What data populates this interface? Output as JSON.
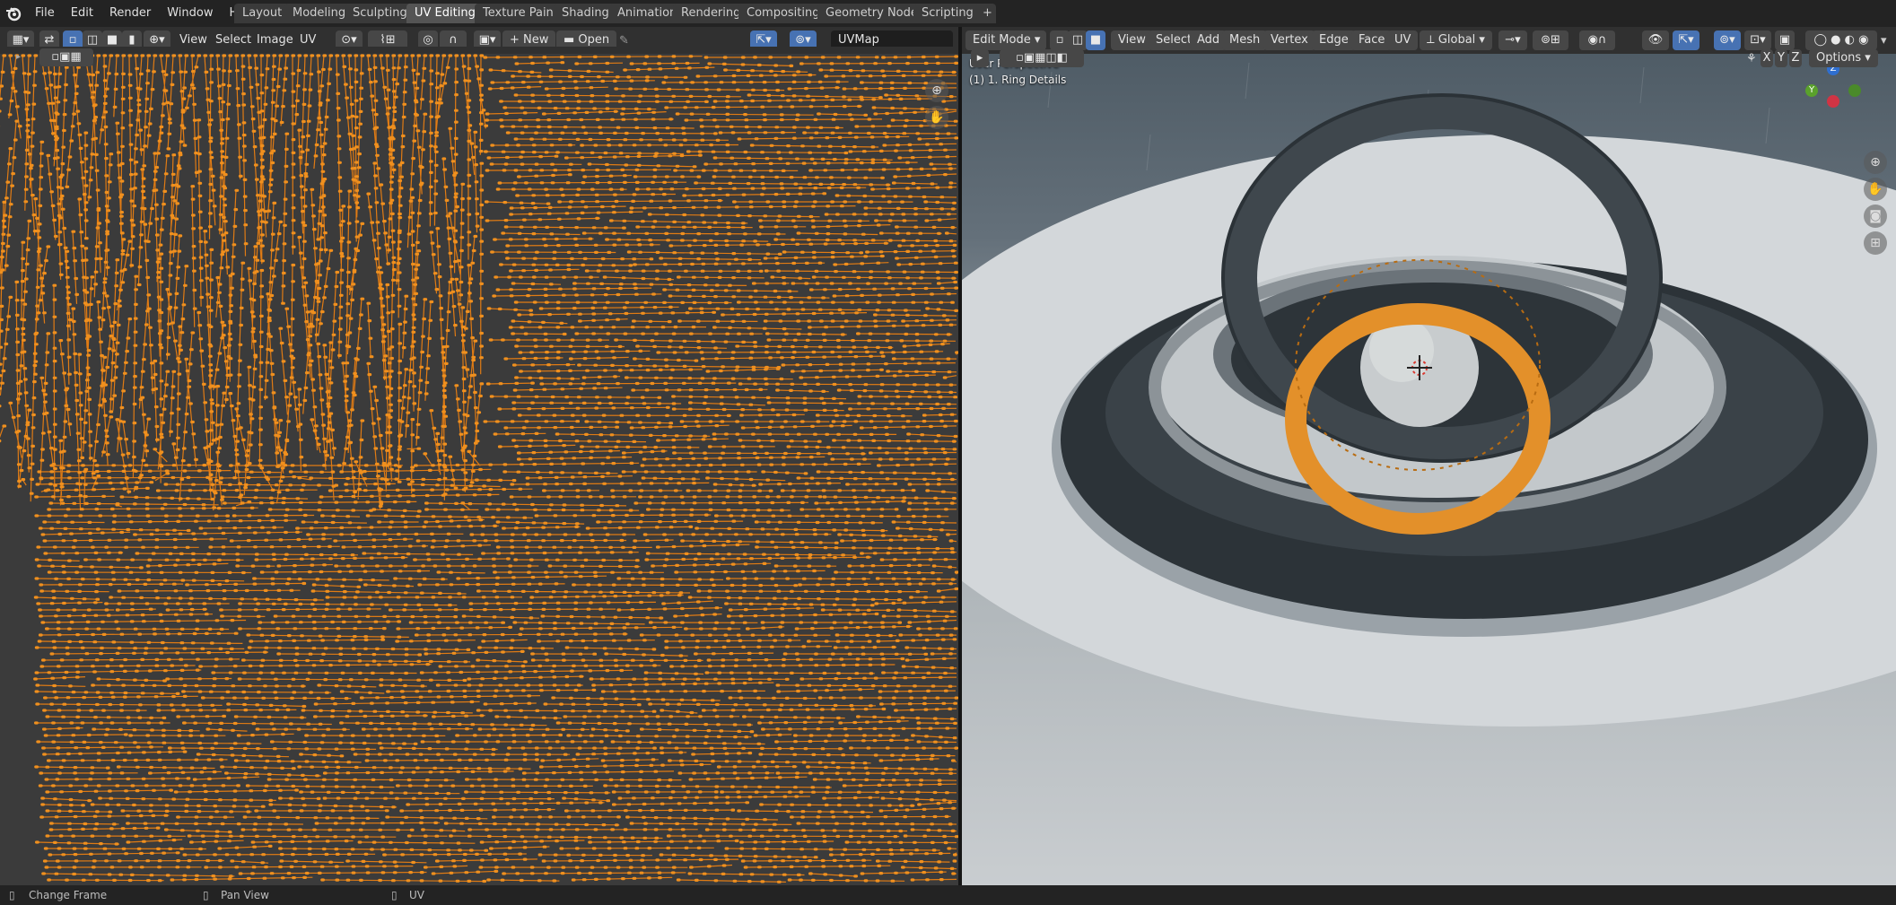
{
  "top_menu": {
    "logo": "blender-logo-icon",
    "items": [
      "File",
      "Edit",
      "Render",
      "Window",
      "Help"
    ]
  },
  "workspaces": {
    "active": "UV Editing",
    "tabs": [
      "Layout",
      "Modeling",
      "Sculpting",
      "UV Editing",
      "Texture Paint",
      "Shading",
      "Animation",
      "Rendering",
      "Compositing",
      "Geometry Nodes",
      "Scripting"
    ],
    "add_label": "+"
  },
  "uv_editor": {
    "menus": [
      "View",
      "Select",
      "Image",
      "UV"
    ],
    "new_label": "New",
    "open_label": "Open",
    "uvmap_value": "UVMap",
    "colors": {
      "background": "#3b3b3b",
      "edge": "#e07b14",
      "vertex": "#f0901e"
    }
  },
  "viewport": {
    "mode": "Edit Mode",
    "menus": [
      "View",
      "Select",
      "Add",
      "Mesh",
      "Vertex",
      "Edge",
      "Face",
      "UV"
    ],
    "transform_orientation": "Global",
    "axis_toggles": [
      "X",
      "Y",
      "Z"
    ],
    "options_label": "Options",
    "overlay_line1": "User Perspective",
    "overlay_line2": "(1) 1. Ring Details",
    "gizmo": {
      "z": "Z",
      "y": "Y"
    },
    "colors": {
      "selection": "#e3902a",
      "floor": "#d4d8da",
      "pit": "#2a3035"
    }
  },
  "statusbar": {
    "items": [
      "Change Frame",
      "Pan View",
      "UV"
    ]
  }
}
